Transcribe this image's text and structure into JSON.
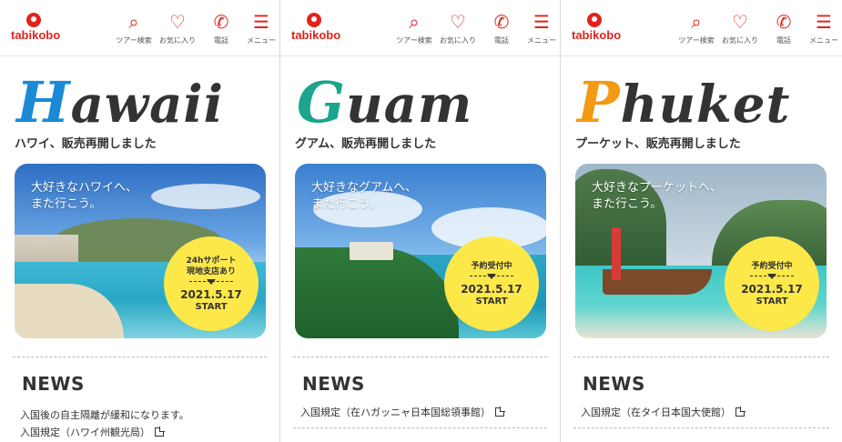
{
  "colors": {
    "brand": "#e2231a",
    "hawaii_accent": "#1a8ad6",
    "guam_accent": "#1aa58c",
    "phuket_accent": "#f39a13",
    "badge": "#fde84a"
  },
  "panels": [
    {
      "header": {
        "logo_text": "tabikobo",
        "nav": [
          {
            "label": "ツアー検索",
            "icon": "search-icon"
          },
          {
            "label": "お気に入り",
            "icon": "heart-icon"
          },
          {
            "label": "電話",
            "icon": "phone-icon"
          },
          {
            "label": "メニュー",
            "icon": "menu-icon"
          }
        ]
      },
      "title_first": "H",
      "title_rest": "awaii",
      "subtitle": "ハワイ、販売再開しました",
      "photo_text": [
        "大好きなハワイへ、",
        "また行こう。"
      ],
      "badge": {
        "line1": "24hサポート",
        "line2": "現地支店あり",
        "date": "2021.5.17",
        "start": "START"
      },
      "news_title": "NEWS",
      "news_items": [
        "入国後の自主隔離が緩和になります。",
        "入国規定（ハワイ州観光局）"
      ]
    },
    {
      "header": {
        "logo_text": "tabikobo",
        "nav": [
          {
            "label": "ツアー検索",
            "icon": "search-icon"
          },
          {
            "label": "お気に入り",
            "icon": "heart-icon"
          },
          {
            "label": "電話",
            "icon": "phone-icon"
          },
          {
            "label": "メニュー",
            "icon": "menu-icon"
          }
        ]
      },
      "title_first": "G",
      "title_rest": "uam",
      "subtitle": "グアム、販売再開しました",
      "photo_text": [
        "大好きなグアムへ、",
        "また行こう。"
      ],
      "badge": {
        "line1": "予約受付中",
        "line2": "",
        "date": "2021.5.17",
        "start": "START"
      },
      "news_title": "NEWS",
      "news_items": [
        "入国規定（在ハガッニャ日本国総領事館）"
      ]
    },
    {
      "header": {
        "logo_text": "tabikobo",
        "nav": [
          {
            "label": "ツアー検索",
            "icon": "search-icon"
          },
          {
            "label": "お気に入り",
            "icon": "heart-icon"
          },
          {
            "label": "電話",
            "icon": "phone-icon"
          },
          {
            "label": "メニュー",
            "icon": "menu-icon"
          }
        ]
      },
      "title_first": "P",
      "title_rest": "huket",
      "subtitle": "プーケット、販売再開しました",
      "photo_text": [
        "大好きなプーケットへ、",
        "また行こう。"
      ],
      "badge": {
        "line1": "予約受付中",
        "line2": "",
        "date": "2021.5.17",
        "start": "START"
      },
      "news_title": "NEWS",
      "news_items": [
        "入国規定（在タイ日本国大使館）"
      ]
    }
  ]
}
